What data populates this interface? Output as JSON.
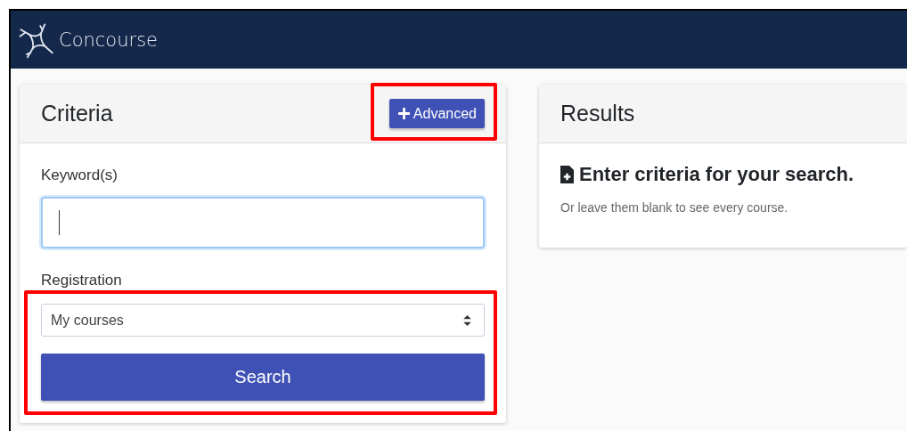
{
  "header": {
    "brand": "Concourse"
  },
  "criteria": {
    "title": "Criteria",
    "advanced_button": {
      "label": "Advanced",
      "highlighted": true
    },
    "keyword": {
      "label": "Keyword(s)",
      "focused": true
    },
    "registration": {
      "label": "Registration",
      "value": "My courses"
    },
    "search_button": {
      "label": "Search"
    },
    "lower_highlighted": true
  },
  "results": {
    "title": "Results",
    "heading": "Enter criteria for your search.",
    "hint": "Or leave them blank to see every course."
  }
}
